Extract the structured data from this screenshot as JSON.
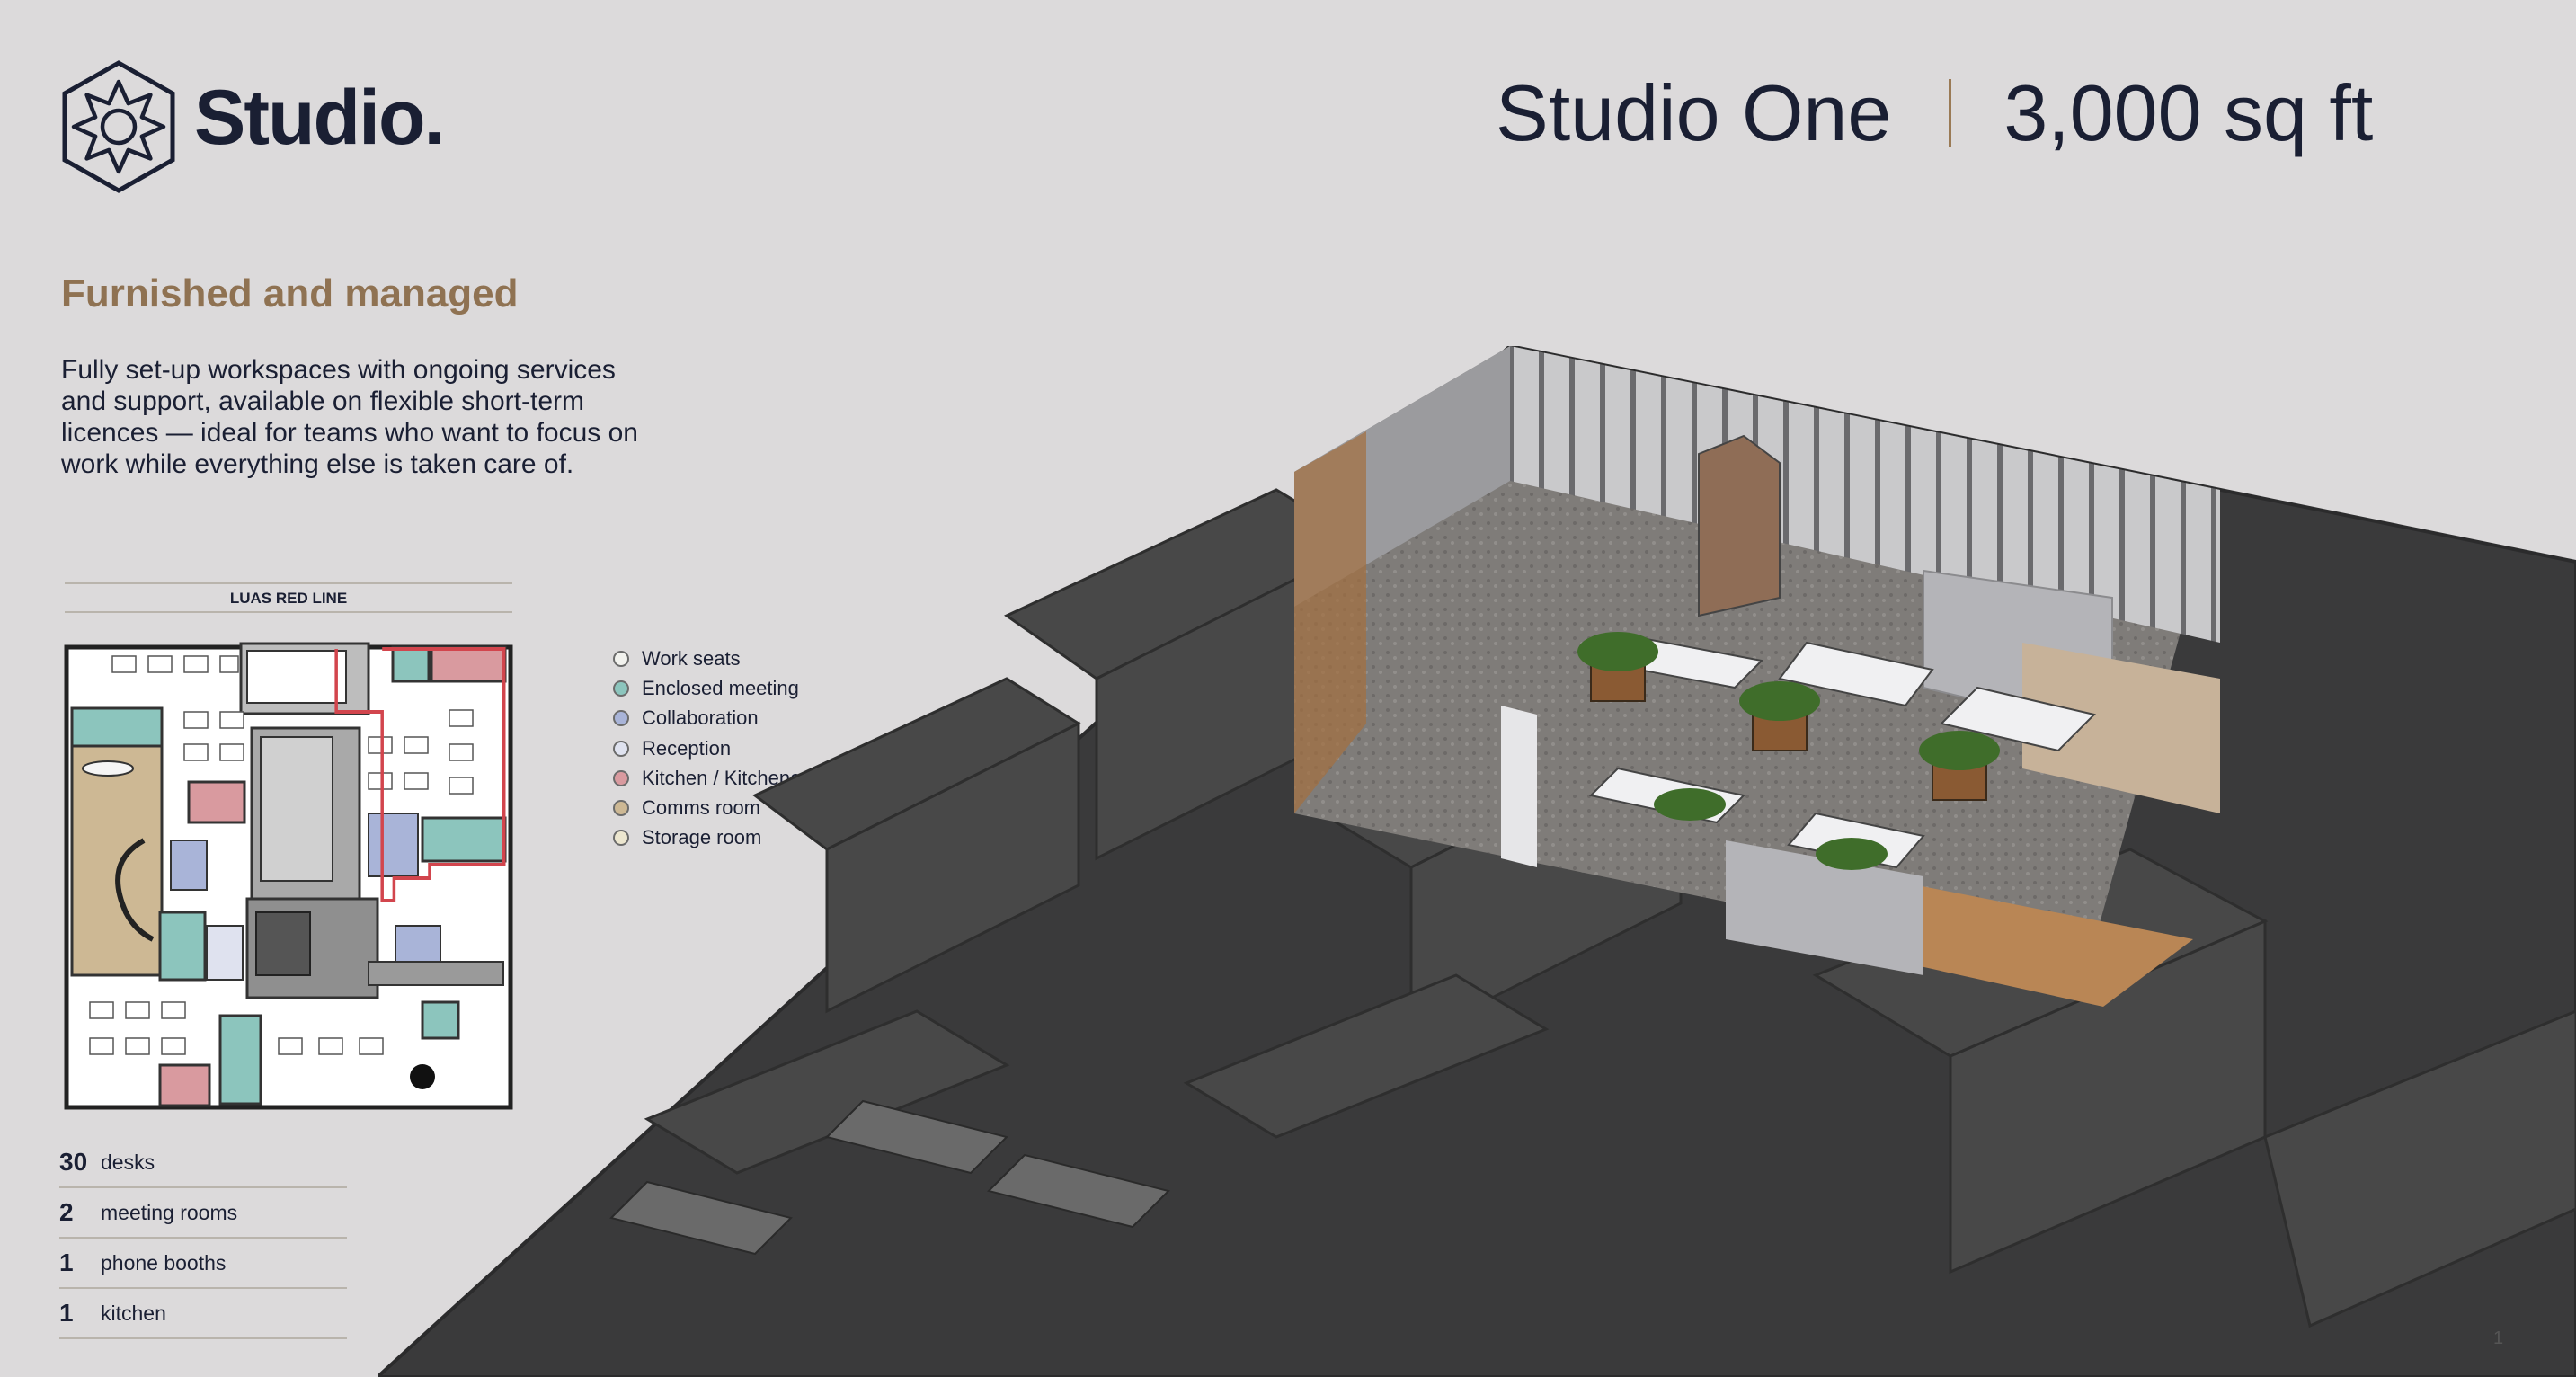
{
  "brand": {
    "name": "Studio.",
    "logo": "studio-sunburst-logo"
  },
  "header": {
    "name": "Studio One",
    "area": "3,000 sq ft"
  },
  "section": {
    "title": "Furnished and managed",
    "description": "Fully set-up workspaces with ongoing services and support, available on flexible short-term licences — ideal for teams who want to focus on work while everything else is taken care of."
  },
  "floorplan": {
    "street_label": "LUAS RED LINE"
  },
  "legend": [
    {
      "label": "Work seats",
      "color": "#f2f2ee"
    },
    {
      "label": "Enclosed meeting",
      "color": "#8cc5bd"
    },
    {
      "label": "Collaboration",
      "color": "#a9b4d8"
    },
    {
      "label": "Reception",
      "color": "#dfe2ef"
    },
    {
      "label": "Kitchen / Kitchenette",
      "color": "#d99a9f"
    },
    {
      "label": "Comms room",
      "color": "#cdb894"
    },
    {
      "label": "Storage room",
      "color": "#ece6cf"
    }
  ],
  "stats": [
    {
      "num": "30",
      "label": "desks"
    },
    {
      "num": "2",
      "label": "meeting rooms"
    },
    {
      "num": "1",
      "label": "phone booths"
    },
    {
      "num": "1",
      "label": "kitchen"
    }
  ],
  "page_number": "1",
  "colors": {
    "navy": "#1a1f33",
    "accent_brown": "#8f7252",
    "background": "#dcdadb",
    "highlight_red": "#d2454d"
  }
}
